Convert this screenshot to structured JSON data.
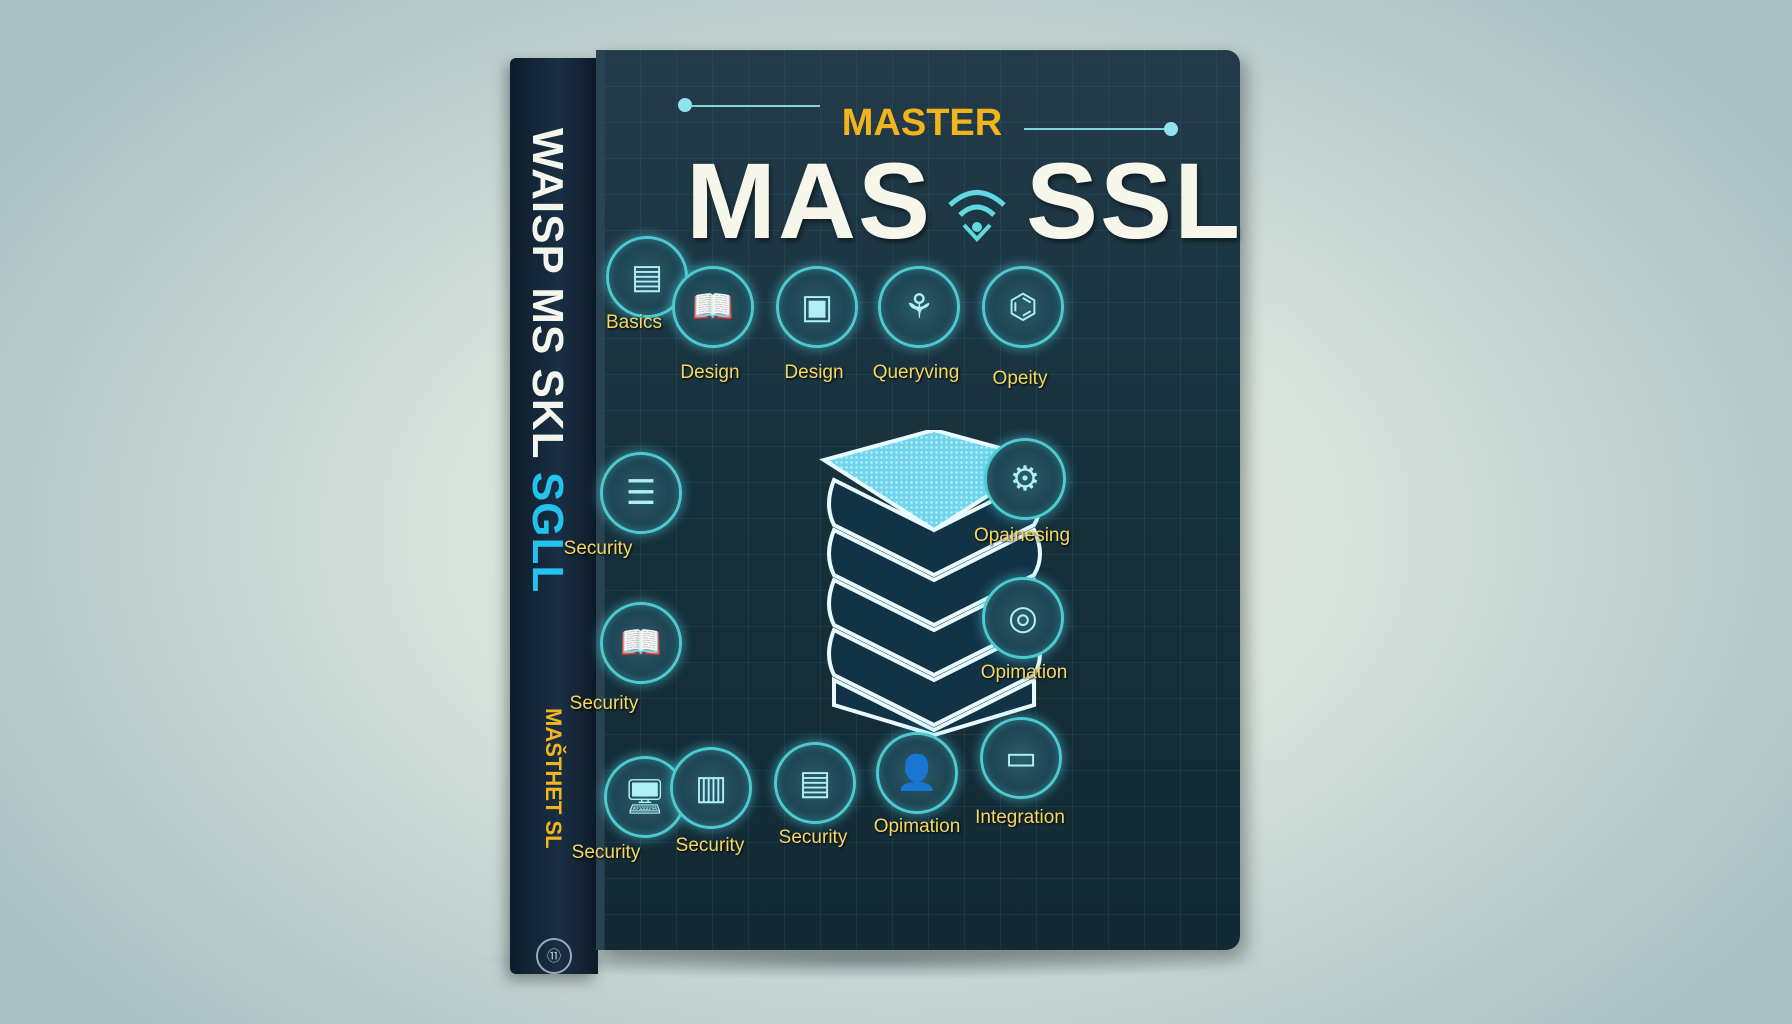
{
  "cover": {
    "kicker": "MASTER",
    "title_left": "MAS",
    "title_right": "SSL",
    "topics": [
      {
        "label": "Basics",
        "icon": "document-icon"
      },
      {
        "label": "Design",
        "icon": "open-book-icon"
      },
      {
        "label": "Design",
        "icon": "monitor-document-icon"
      },
      {
        "label": "Queryving",
        "icon": "network-icon"
      },
      {
        "label": "Opeity",
        "icon": "graph-icon"
      },
      {
        "label": "Security",
        "icon": "table-icon"
      },
      {
        "label": "Security",
        "icon": "open-book-icon"
      },
      {
        "label": "Opainesing",
        "icon": "workflow-icon"
      },
      {
        "label": "Opimation",
        "icon": "target-icon"
      },
      {
        "label": "Security",
        "icon": "monitor-icon"
      },
      {
        "label": "Security",
        "icon": "pages-icon"
      },
      {
        "label": "Security",
        "icon": "document-icon"
      },
      {
        "label": "Opimation",
        "icon": "users-icon"
      },
      {
        "label": "Integration",
        "icon": "screen-icon"
      }
    ]
  },
  "spine": {
    "title_white": "WAISP MS SKL ",
    "title_cyan": "SGLL",
    "subtitle": "MAŠTHET SL",
    "publisher_mark": "⑪"
  },
  "colors": {
    "accent_yellow": "#f2b41a",
    "accent_cyan": "#4fc9d0",
    "cover_bg": "#1a3340"
  }
}
